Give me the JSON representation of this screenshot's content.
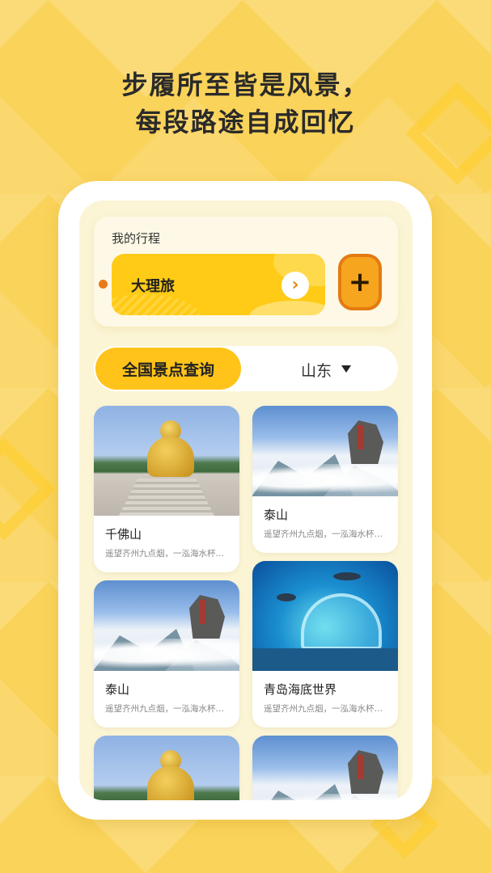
{
  "headline": {
    "line1": "步履所至皆是风景，",
    "line2": "每段路途自成回忆"
  },
  "trip_section": {
    "title": "我的行程",
    "current_trip": "大理旅",
    "arrow": "›",
    "add_label": "+"
  },
  "query": {
    "button_label": "全国景点查询",
    "region": "山东"
  },
  "spots": [
    {
      "name": "千佛山",
      "desc": "遥望齐州九点烟，一泓海水杯中泻。",
      "image": "buddha-statue"
    },
    {
      "name": "泰山",
      "desc": "遥望齐州九点烟，一泓海水杯中泻。",
      "image": "mountain-clouds"
    },
    {
      "name": "泰山",
      "desc": "遥望齐州九点烟，一泓海水杯中泻。",
      "image": "mountain-clouds"
    },
    {
      "name": "青岛海底世界",
      "desc": "遥望齐州九点烟，一泓海水杯中泻。",
      "image": "aquarium-tunnel"
    },
    {
      "name": "",
      "desc": "",
      "image": "buddha-statue"
    },
    {
      "name": "",
      "desc": "",
      "image": "mountain-clouds"
    }
  ],
  "colors": {
    "background": "#fad35a",
    "accent": "#ffc31a",
    "add_button": "#f6a51e",
    "bullet": "#e9791a"
  }
}
